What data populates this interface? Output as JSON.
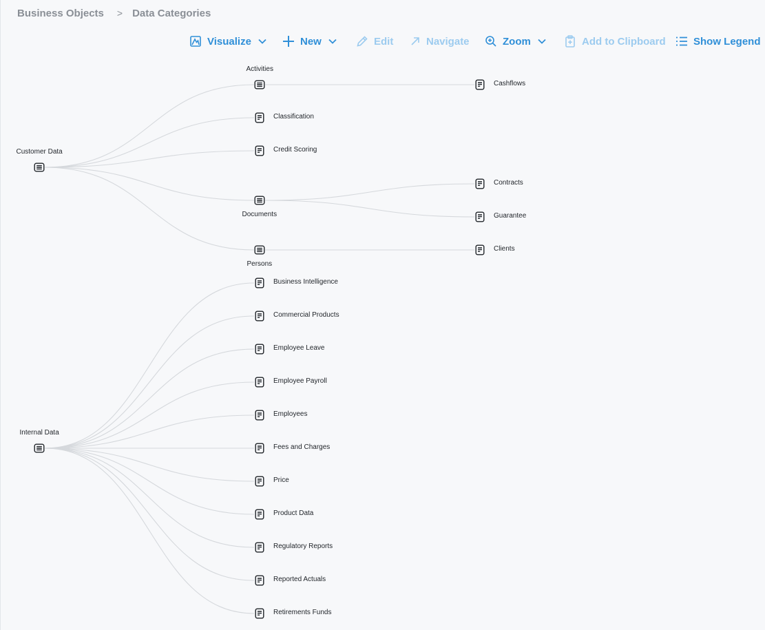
{
  "breadcrumb": {
    "parent": "Business Objects",
    "current": "Data Categories"
  },
  "toolbar": {
    "visualize": "Visualize",
    "new": "New",
    "edit": "Edit",
    "navigate": "Navigate",
    "zoom": "Zoom",
    "add_to_clipboard": "Add to Clipboard",
    "show_legend": "Show Legend"
  },
  "colors": {
    "accent": "#2f8fd8",
    "accent_disabled": "#9ccbef",
    "edge": "#d5d8dc",
    "node_icon": "#1f2328"
  },
  "graph": {
    "nodes": [
      {
        "id": "customer-data",
        "label": "Customer Data",
        "kind": "category"
      },
      {
        "id": "activities",
        "label": "Activities",
        "kind": "category"
      },
      {
        "id": "classification",
        "label": "Classification",
        "kind": "object"
      },
      {
        "id": "credit-scoring",
        "label": "Credit Scoring",
        "kind": "object"
      },
      {
        "id": "documents",
        "label": "Documents",
        "kind": "category"
      },
      {
        "id": "persons",
        "label": "Persons",
        "kind": "category"
      },
      {
        "id": "cashflows",
        "label": "Cashflows",
        "kind": "object"
      },
      {
        "id": "contracts",
        "label": "Contracts",
        "kind": "object"
      },
      {
        "id": "guarantee",
        "label": "Guarantee",
        "kind": "object"
      },
      {
        "id": "clients",
        "label": "Clients",
        "kind": "object"
      },
      {
        "id": "internal-data",
        "label": "Internal Data",
        "kind": "category"
      },
      {
        "id": "business-intelligence",
        "label": "Business Intelligence",
        "kind": "object"
      },
      {
        "id": "commercial-products",
        "label": "Commercial Products",
        "kind": "object"
      },
      {
        "id": "employee-leave",
        "label": "Employee Leave",
        "kind": "object"
      },
      {
        "id": "employee-payroll",
        "label": "Employee Payroll",
        "kind": "object"
      },
      {
        "id": "employees",
        "label": "Employees",
        "kind": "object"
      },
      {
        "id": "fees-and-charges",
        "label": "Fees and Charges",
        "kind": "object"
      },
      {
        "id": "price",
        "label": "Price",
        "kind": "object"
      },
      {
        "id": "product-data",
        "label": "Product Data",
        "kind": "object"
      },
      {
        "id": "regulatory-reports",
        "label": "Regulatory Reports",
        "kind": "object"
      },
      {
        "id": "reported-actuals",
        "label": "Reported Actuals",
        "kind": "object"
      },
      {
        "id": "retirements-funds",
        "label": "Retirements Funds",
        "kind": "object"
      }
    ],
    "edges": [
      [
        "customer-data",
        "activities"
      ],
      [
        "customer-data",
        "classification"
      ],
      [
        "customer-data",
        "credit-scoring"
      ],
      [
        "customer-data",
        "documents"
      ],
      [
        "customer-data",
        "persons"
      ],
      [
        "activities",
        "cashflows"
      ],
      [
        "documents",
        "contracts"
      ],
      [
        "documents",
        "guarantee"
      ],
      [
        "persons",
        "clients"
      ],
      [
        "internal-data",
        "business-intelligence"
      ],
      [
        "internal-data",
        "commercial-products"
      ],
      [
        "internal-data",
        "employee-leave"
      ],
      [
        "internal-data",
        "employee-payroll"
      ],
      [
        "internal-data",
        "employees"
      ],
      [
        "internal-data",
        "fees-and-charges"
      ],
      [
        "internal-data",
        "price"
      ],
      [
        "internal-data",
        "product-data"
      ],
      [
        "internal-data",
        "regulatory-reports"
      ],
      [
        "internal-data",
        "reported-actuals"
      ],
      [
        "internal-data",
        "retirements-funds"
      ]
    ]
  }
}
